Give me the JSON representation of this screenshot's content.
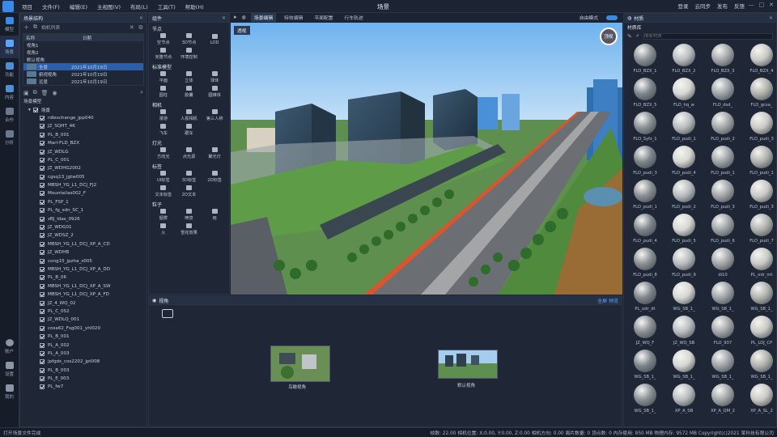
{
  "titlebar": {
    "title": "场景",
    "menus": [
      "项目",
      "文件(F)",
      "编辑(E)",
      "主视图(V)",
      "布局(L)",
      "工具(T)",
      "帮助(H)"
    ],
    "right": [
      "登录",
      "云同步",
      "发布",
      "反馈"
    ]
  },
  "leftstrip": [
    "模型",
    "场景",
    "功能",
    "内容",
    "合作",
    "分析",
    "账户",
    "设置",
    "我的"
  ],
  "scene": {
    "title": "场景结构",
    "camera_header": "相机列表",
    "camera_cols": [
      "名称",
      "日期"
    ],
    "cameras": [
      {
        "label": "视角1",
        "date": "2021年10月19日"
      },
      {
        "label": "视角2",
        "date": ""
      },
      {
        "label": "默认视角",
        "date": ""
      },
      {
        "label": "全景",
        "date": "2021年10月19日"
      },
      {
        "label": "俯视视角",
        "date": "2021年10月19日"
      },
      {
        "label": "远景",
        "date": "2021年10月19日"
      }
    ],
    "tree_header": "场景模型",
    "root": "场景",
    "items": [
      "rdlexchange_jpp040",
      "JZ_SQHT_4K",
      "PL_B_001",
      "Marl-FLD_BZX",
      "JZ_WDLG",
      "PL_C_001",
      "JZ_WDHG2002",
      "cgsq13_jgtw005",
      "MBSH_YG_L1_DCJ_FJ2",
      "Mountailas002_F",
      "PL_FSP_1",
      "PL_fg_sdn_SC_1",
      "zBJ_ldas_0926",
      "JZ_WDG01",
      "JZ_WDSZ_2",
      "MBSH_YG_L1_DCJ_XP_A_CD",
      "JZ_WDHB",
      "cong15_jpzha_s005",
      "MBSH_YG_L1_DCJ_XP_A_DD",
      "PL_B_06",
      "MBSH_YG_L1_DCJ_XP_A_SW",
      "MBSH_YG_L1_DCJ_XP_A_FD",
      "JZ_4_WQ_02",
      "PL_C_0S2",
      "JZ_WDLQ_001",
      "cosa62_Fsg001_yhl020",
      "PL_B_001",
      "PL_A_002",
      "PL_A_003",
      "jpfgds_cos2202_jpt008",
      "PL_B_003",
      "PL_E_003",
      "PL_fw7"
    ]
  },
  "components": {
    "title": "组件",
    "groups": [
      {
        "name": "节点",
        "items": [
          "空节点",
          "3D节点",
          "LOD",
          "克隆节点",
          "环境控制"
        ]
      },
      {
        "name": "标准模型",
        "items": [
          "平面",
          "立体",
          "球体",
          "圆柱",
          "胶囊",
          "圆锥体"
        ]
      },
      {
        "name": "相机",
        "items": [
          "漫游",
          "人视相机",
          "第三人称",
          "飞车",
          "跟车"
        ]
      },
      {
        "name": "灯光",
        "items": [
          "方向光",
          "点光源",
          "聚光灯"
        ]
      },
      {
        "name": "标签",
        "items": [
          "UI标签",
          "3D标签",
          "2D标签",
          "文本标签",
          "2D文本"
        ]
      },
      {
        "name": "粒子",
        "items": [
          "烟雾",
          "喷泉",
          "雨",
          "火",
          "雪花效果"
        ]
      }
    ]
  },
  "viewport": {
    "tabs": [
      "场景编辑",
      "特效编辑",
      "平面配置",
      "行车轨迹"
    ],
    "active_tab": "场景编辑",
    "corner_label": "透视",
    "mode_label": "自由模式",
    "compass": "顶视"
  },
  "camera_panel": {
    "title": "视角",
    "right_label": "全屏 预览",
    "shots": [
      "鸟瞰视角",
      "默认视角"
    ]
  },
  "materials": {
    "title": "材质",
    "tab_label": "材质库",
    "search_placeholder": "搜索材质",
    "items": [
      "FLO_BZX_1",
      "FLO_BZX_2",
      "FLO_BZX_3",
      "FLO_BZX_4",
      "FLO_BZX_5",
      "FLO_hq_w",
      "FLO_dsd_",
      "FLO_gcsa_",
      "FLO_Syfz_1",
      "FLO_pudi_1",
      "FLO_pudi_2",
      "FLO_pudi_3",
      "FLO_pudi_3",
      "FLO_pudi_4",
      "FLO_pudi_1",
      "FLO_pudi_1",
      "FLO_pudi_1",
      "FLO_pudi_2",
      "FLO_pudi_3",
      "FLO_pudi_3",
      "FLO_pudi_4",
      "FLO_pudi_5",
      "FLO_pudi_6",
      "FLO_pudi_7",
      "FLO_pudi_8",
      "FLO_pudi_9",
      "di10",
      "PL_odr_mt",
      "PL_odr_dt",
      "WG_SB_1_",
      "WG_SB_1_",
      "WG_SB_1_",
      "JZ_WQ_F",
      "JZ_WQ_SB",
      "FLO_937",
      "PL_LOJ_CP",
      "WG_SB_1_",
      "WG_SB_1_",
      "WG_SB_1_",
      "WG_SB_1_",
      "WG_SB_1_",
      "XP_A_SB",
      "XP_A_QM_2",
      "XP_A_SL_2"
    ]
  },
  "status": {
    "left": "打开场景文件完成",
    "right": "帧数: 22.00  相机位置: X:0.00, Y:0.00, Z:0.00  相机方向: 0.00  面片数量: 0  顶点数: 0  内存使用: 850 MB  物理内存: 9572 MB  Copyright(c)2021 某科技有限公司"
  }
}
